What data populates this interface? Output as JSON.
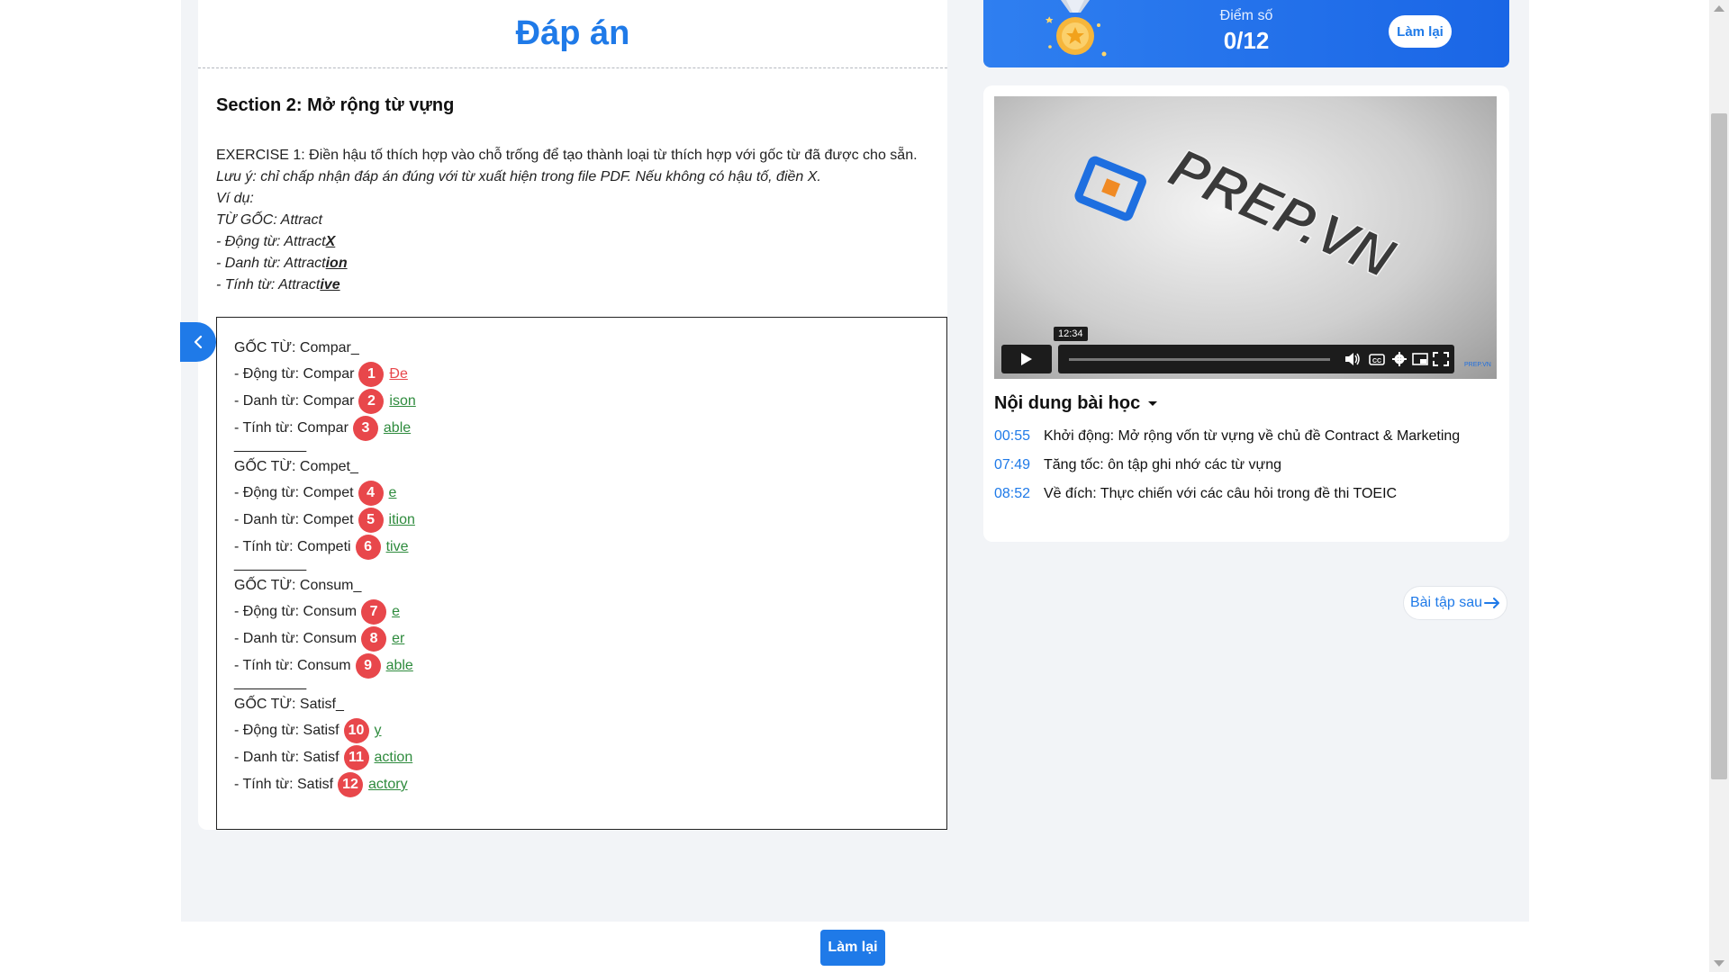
{
  "answer": {
    "title": "Đáp án",
    "section_title": "Section 2: Mở rộng từ vựng",
    "exercise": {
      "line1": "EXERCISE 1: Điền hậu tố thích hợp vào chỗ trống để tạo thành loại từ thích hợp với gốc từ đã được cho sẵn.",
      "note": "Lưu ý: chỉ chấp nhận đáp án đúng với từ xuất hiện trong file PDF. Nếu không có hậu tố, điền X.",
      "example_label": "Ví dụ:",
      "example_root": "TỪ GỐC: Attract",
      "ex_verb_prefix": "- Động từ: Attract",
      "ex_verb_suffix": "X",
      "ex_noun_prefix": "- Danh từ: Attract",
      "ex_noun_suffix": "ion",
      "ex_adj_prefix": "- Tính từ: Attract",
      "ex_adj_suffix": "ive"
    },
    "separator": "_________",
    "groups": [
      {
        "root": "GỐC TỪ: Compar_",
        "rows": [
          {
            "label": "- Động từ: Compar",
            "num": "1",
            "answer": "Đe",
            "status": "wrong"
          },
          {
            "label": "- Danh từ: Compar",
            "num": "2",
            "answer": "ison",
            "status": "correct"
          },
          {
            "label": "- Tính từ: Compar",
            "num": "3",
            "answer": "able",
            "status": "correct"
          }
        ]
      },
      {
        "root": "GỐC TỪ: Compet_",
        "rows": [
          {
            "label": "- Động từ: Compet",
            "num": "4",
            "answer": "e",
            "status": "correct"
          },
          {
            "label": "- Danh từ: Compet",
            "num": "5",
            "answer": "ition",
            "status": "correct"
          },
          {
            "label": "- Tính từ: Competi",
            "num": "6",
            "answer": "tive",
            "status": "correct"
          }
        ]
      },
      {
        "root": "GỐC TỪ: Consum_",
        "rows": [
          {
            "label": "- Động từ: Consum",
            "num": "7",
            "answer": "e",
            "status": "correct"
          },
          {
            "label": "- Danh từ: Consum",
            "num": "8",
            "answer": "er",
            "status": "correct"
          },
          {
            "label": "- Tính từ: Consum",
            "num": "9",
            "answer": "able",
            "status": "correct"
          }
        ]
      },
      {
        "root": "GỐC TỪ: Satisf_",
        "rows": [
          {
            "label": "- Động từ: Satisf",
            "num": "10",
            "answer": "y",
            "status": "correct"
          },
          {
            "label": "- Danh từ: Satisf",
            "num": "11",
            "answer": "action",
            "status": "correct"
          },
          {
            "label": "- Tính từ: Satisf",
            "num": "12",
            "answer": "actory",
            "status": "correct"
          }
        ]
      }
    ]
  },
  "score": {
    "label": "Điểm số",
    "value": "0/12",
    "retry_label": "Làm lại"
  },
  "video": {
    "logo_text": "PREP.VN",
    "time_tooltip": "12:34",
    "watermark": "PREP.VN"
  },
  "lesson": {
    "heading": "Nội dung bài học",
    "items": [
      {
        "time": "00:55",
        "text": "Khởi động: Mở rộng vốn từ vựng về chủ đề Contract & Marketing"
      },
      {
        "time": "07:49",
        "text": "Tăng tốc: ôn tập ghi nhớ các từ vựng"
      },
      {
        "time": "08:52",
        "text": "Về đích: Thực chiến với các câu hỏi trong đề thi TOEIC"
      }
    ]
  },
  "nav": {
    "next_label": "Bài tập sau",
    "bottom_retry_label": "Làm lại"
  },
  "colors": {
    "accent": "#1f7ae8",
    "badge": "#e8474b",
    "correct": "#2e8b3d"
  }
}
